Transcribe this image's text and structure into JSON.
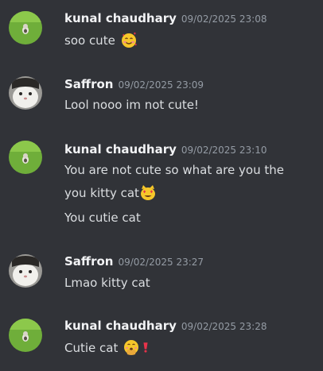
{
  "messages": [
    {
      "author": "kunal chaudhary",
      "timestamp": "09/02/2025 23:08",
      "avatar": "grass-cat-avatar",
      "lines": [
        {
          "text": "soo cute",
          "emoji": "smiling-face-with-hearts"
        }
      ]
    },
    {
      "author": "Saffron",
      "timestamp": "09/02/2025 23:09",
      "avatar": "bw-cat-avatar",
      "lines": [
        {
          "text": "Lool nooo im not cute!"
        }
      ]
    },
    {
      "author": "kunal chaudhary",
      "timestamp": "09/02/2025 23:10",
      "avatar": "grass-cat-avatar",
      "lines": [
        {
          "text": "You are not cute so what are you the"
        },
        {
          "text": "you kitty cat",
          "emoji": "heart-eyes-cat"
        },
        {
          "text": "You cutie cat"
        }
      ]
    },
    {
      "author": "Saffron",
      "timestamp": "09/02/2025 23:27",
      "avatar": "bw-cat-avatar",
      "lines": [
        {
          "text": "Lmao kitty cat"
        }
      ]
    },
    {
      "author": "kunal chaudhary",
      "timestamp": "09/02/2025 23:28",
      "avatar": "grass-cat-avatar",
      "lines": [
        {
          "text": "Cutie cat",
          "emoji": "face-with-hand-over-mouth",
          "emoji2": "heavy-exclamation-mark"
        }
      ]
    }
  ],
  "colors": {
    "background": "#313338",
    "author": "#f2f3f5",
    "timestamp": "#949ba4",
    "text": "#dbdee1"
  }
}
